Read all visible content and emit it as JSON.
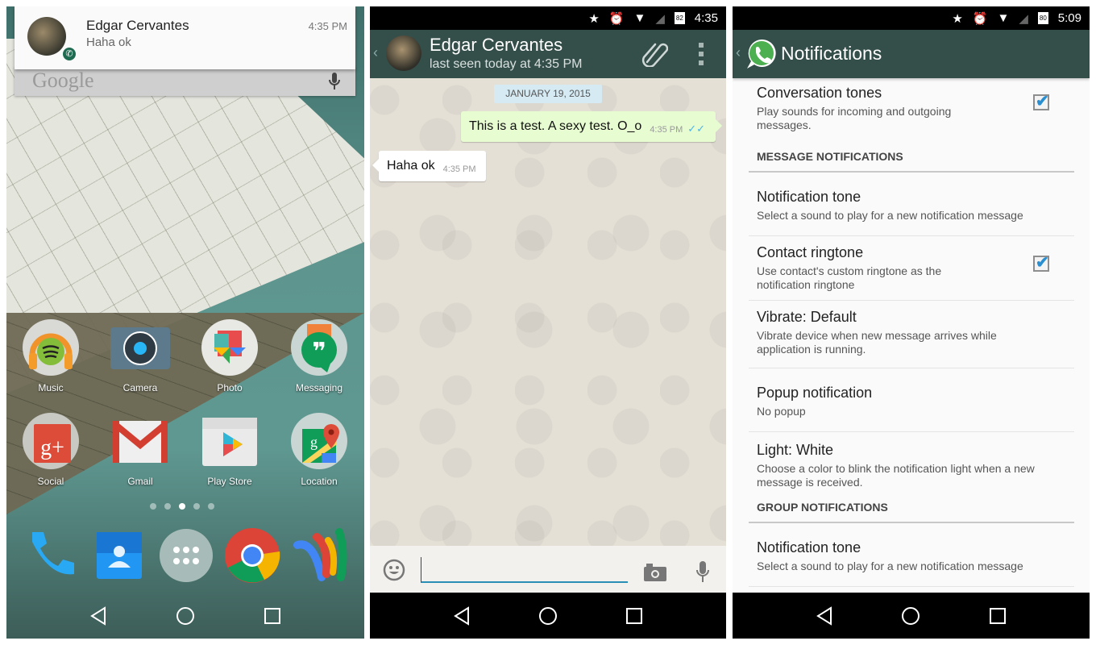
{
  "home": {
    "notification": {
      "sender": "Edgar Cervantes",
      "message": "Haha ok",
      "time": "4:35 PM",
      "app_icon": "whatsapp-icon"
    },
    "search": {
      "logo": "Google",
      "icon": "mic-icon"
    },
    "apps": [
      {
        "label": "Music",
        "icon": "music-icon"
      },
      {
        "label": "Camera",
        "icon": "camera-icon"
      },
      {
        "label": "Photo",
        "icon": "photos-icon"
      },
      {
        "label": "Messaging",
        "icon": "hangouts-icon"
      },
      {
        "label": "Social",
        "icon": "google-plus-icon"
      },
      {
        "label": "Gmail",
        "icon": "gmail-icon"
      },
      {
        "label": "Play Store",
        "icon": "play-store-icon"
      },
      {
        "label": "Location",
        "icon": "maps-icon"
      }
    ],
    "page_indicator": {
      "pages": 5,
      "current": 3
    },
    "dock": [
      "phone-icon",
      "contacts-icon",
      "app-drawer-icon",
      "chrome-icon",
      "wallet-icon"
    ]
  },
  "chat": {
    "status_time": "4:35",
    "battery": "82",
    "contact_name": "Edgar Cervantes",
    "last_seen": "last seen today at 4:35 PM",
    "date_chip": "JANUARY 19, 2015",
    "messages": [
      {
        "direction": "outgoing",
        "text": "This is a test. A sexy test. O_o",
        "time": "4:35 PM",
        "status": "read"
      },
      {
        "direction": "incoming",
        "text": "Haha ok",
        "time": "4:35 PM"
      }
    ],
    "composer": {
      "value": "",
      "placeholder": ""
    }
  },
  "settings": {
    "status_time": "5:09",
    "battery": "80",
    "title": "Notifications",
    "items": [
      {
        "type": "pref",
        "title": "Conversation tones",
        "summary": "Play sounds for incoming and outgoing messages.",
        "checked": true
      },
      {
        "type": "category",
        "title": "MESSAGE NOTIFICATIONS"
      },
      {
        "type": "pref",
        "title": "Notification tone",
        "summary": "Select a sound to play for a new notification message"
      },
      {
        "type": "pref",
        "title": "Contact ringtone",
        "summary": "Use contact's custom ringtone as the notification ringtone",
        "checked": true
      },
      {
        "type": "pref",
        "title": "Vibrate: Default",
        "summary": "Vibrate device when new message arrives while application is running."
      },
      {
        "type": "pref",
        "title": "Popup notification",
        "summary": "No popup"
      },
      {
        "type": "pref",
        "title": "Light: White",
        "summary": "Choose a color to blink the notification light when a new message is received."
      },
      {
        "type": "category",
        "title": "GROUP NOTIFICATIONS"
      },
      {
        "type": "pref",
        "title": "Notification tone",
        "summary": "Select a sound to play for a new notification message"
      }
    ]
  },
  "colors": {
    "whatsapp_bar": "#344e4a",
    "outgoing_bubble": "#e7fdd1",
    "checkbox_check": "#2a8fd0",
    "read_ticks": "#4fb3e8",
    "input_underline": "#2a8fb5"
  }
}
